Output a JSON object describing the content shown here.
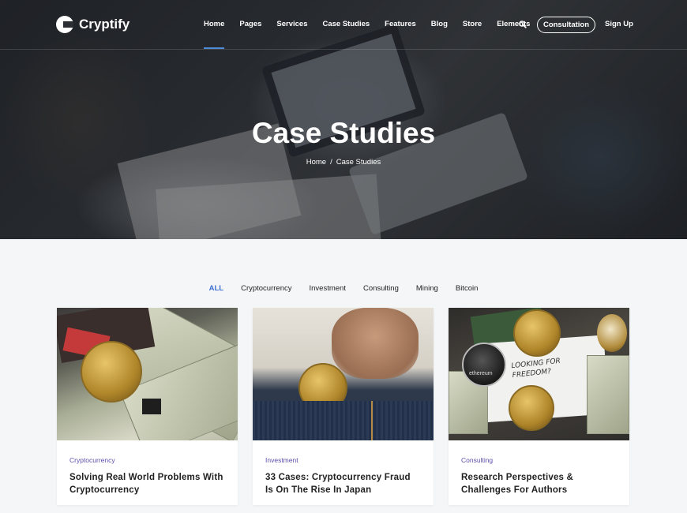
{
  "brand": {
    "name": "Cryptify"
  },
  "nav": {
    "items": [
      {
        "label": "Home",
        "active": true
      },
      {
        "label": "Pages"
      },
      {
        "label": "Services"
      },
      {
        "label": "Case Studies"
      },
      {
        "label": "Features"
      },
      {
        "label": "Blog"
      },
      {
        "label": "Store"
      },
      {
        "label": "Elements"
      }
    ],
    "search_icon": "search-icon",
    "consultation_label": "Consultation",
    "signup_label": "Sign Up"
  },
  "hero": {
    "title": "Case Studies",
    "breadcrumb": {
      "home": "Home",
      "separator": "/",
      "current": "Case Studies"
    }
  },
  "filters": [
    {
      "label": "ALL",
      "active": true
    },
    {
      "label": "Cryptocurrency"
    },
    {
      "label": "Investment"
    },
    {
      "label": "Consulting"
    },
    {
      "label": "Mining"
    },
    {
      "label": "Bitcoin"
    }
  ],
  "cards": [
    {
      "category": "Cryptocurrency",
      "title": "Solving Real World Problems With Cryptocurrency"
    },
    {
      "category": "Investment",
      "title": "33 Cases: Cryptocurrency Fraud Is On The Rise In Japan"
    },
    {
      "category": "Consulting",
      "title": "Research Perspectives & Challenges For Authors"
    }
  ],
  "images": {
    "card3_handwriting": "LOOKING FOR FREEDOM?",
    "card3_coin_label": "ethereum"
  },
  "colors": {
    "accent": "#3d6fd1",
    "category": "#5a4ea8",
    "active_underline": "#4e8ad6"
  }
}
